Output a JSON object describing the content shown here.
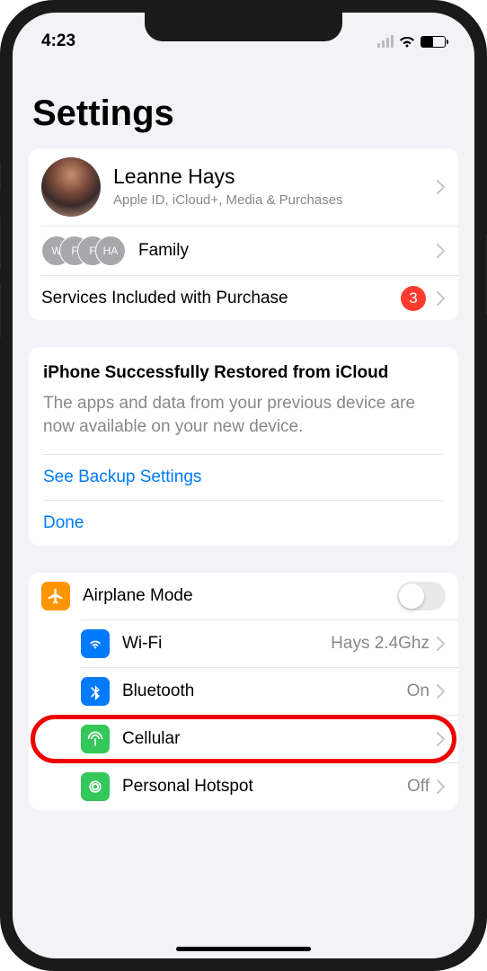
{
  "status": {
    "time": "4:23"
  },
  "page": {
    "title": "Settings"
  },
  "profile": {
    "name": "Leanne Hays",
    "subtitle": "Apple ID, iCloud+, Media & Purchases",
    "family_label": "Family",
    "family_initials": [
      "W",
      "F",
      "F",
      "HA"
    ],
    "services_label": "Services Included with Purchase",
    "services_badge": "3"
  },
  "restore": {
    "title": "iPhone Successfully Restored from iCloud",
    "desc": "The apps and data from your previous device are now available on your new device.",
    "backup_link": "See Backup Settings",
    "done_link": "Done"
  },
  "settings": {
    "airplane": {
      "label": "Airplane Mode"
    },
    "wifi": {
      "label": "Wi-Fi",
      "value": "Hays 2.4Ghz"
    },
    "bluetooth": {
      "label": "Bluetooth",
      "value": "On"
    },
    "cellular": {
      "label": "Cellular"
    },
    "hotspot": {
      "label": "Personal Hotspot",
      "value": "Off"
    }
  }
}
